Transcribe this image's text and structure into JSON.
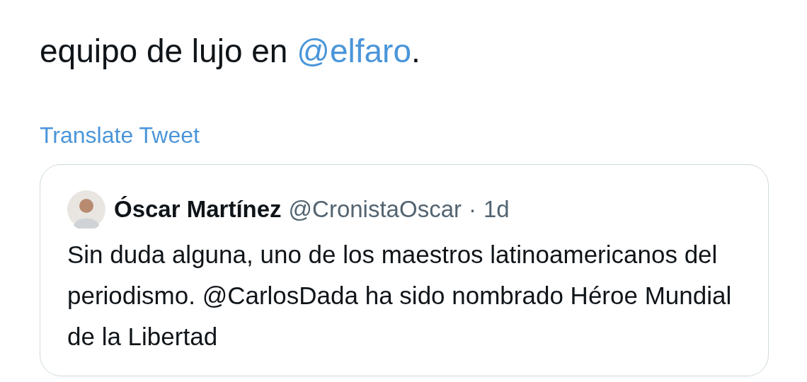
{
  "tweet": {
    "text_before": "equipo de lujo en ",
    "mention": "@elfaro",
    "text_after": ".",
    "translate": "Translate Tweet"
  },
  "quoted_tweet": {
    "name": "Óscar Martínez",
    "handle": "@CronistaOscar",
    "separator": "·",
    "time": "1d",
    "text": "Sin duda alguna, uno de los maestros latinoamericanos del periodismo. @CarlosDada ha sido nombrado Héroe Mundial de la Libertad"
  }
}
